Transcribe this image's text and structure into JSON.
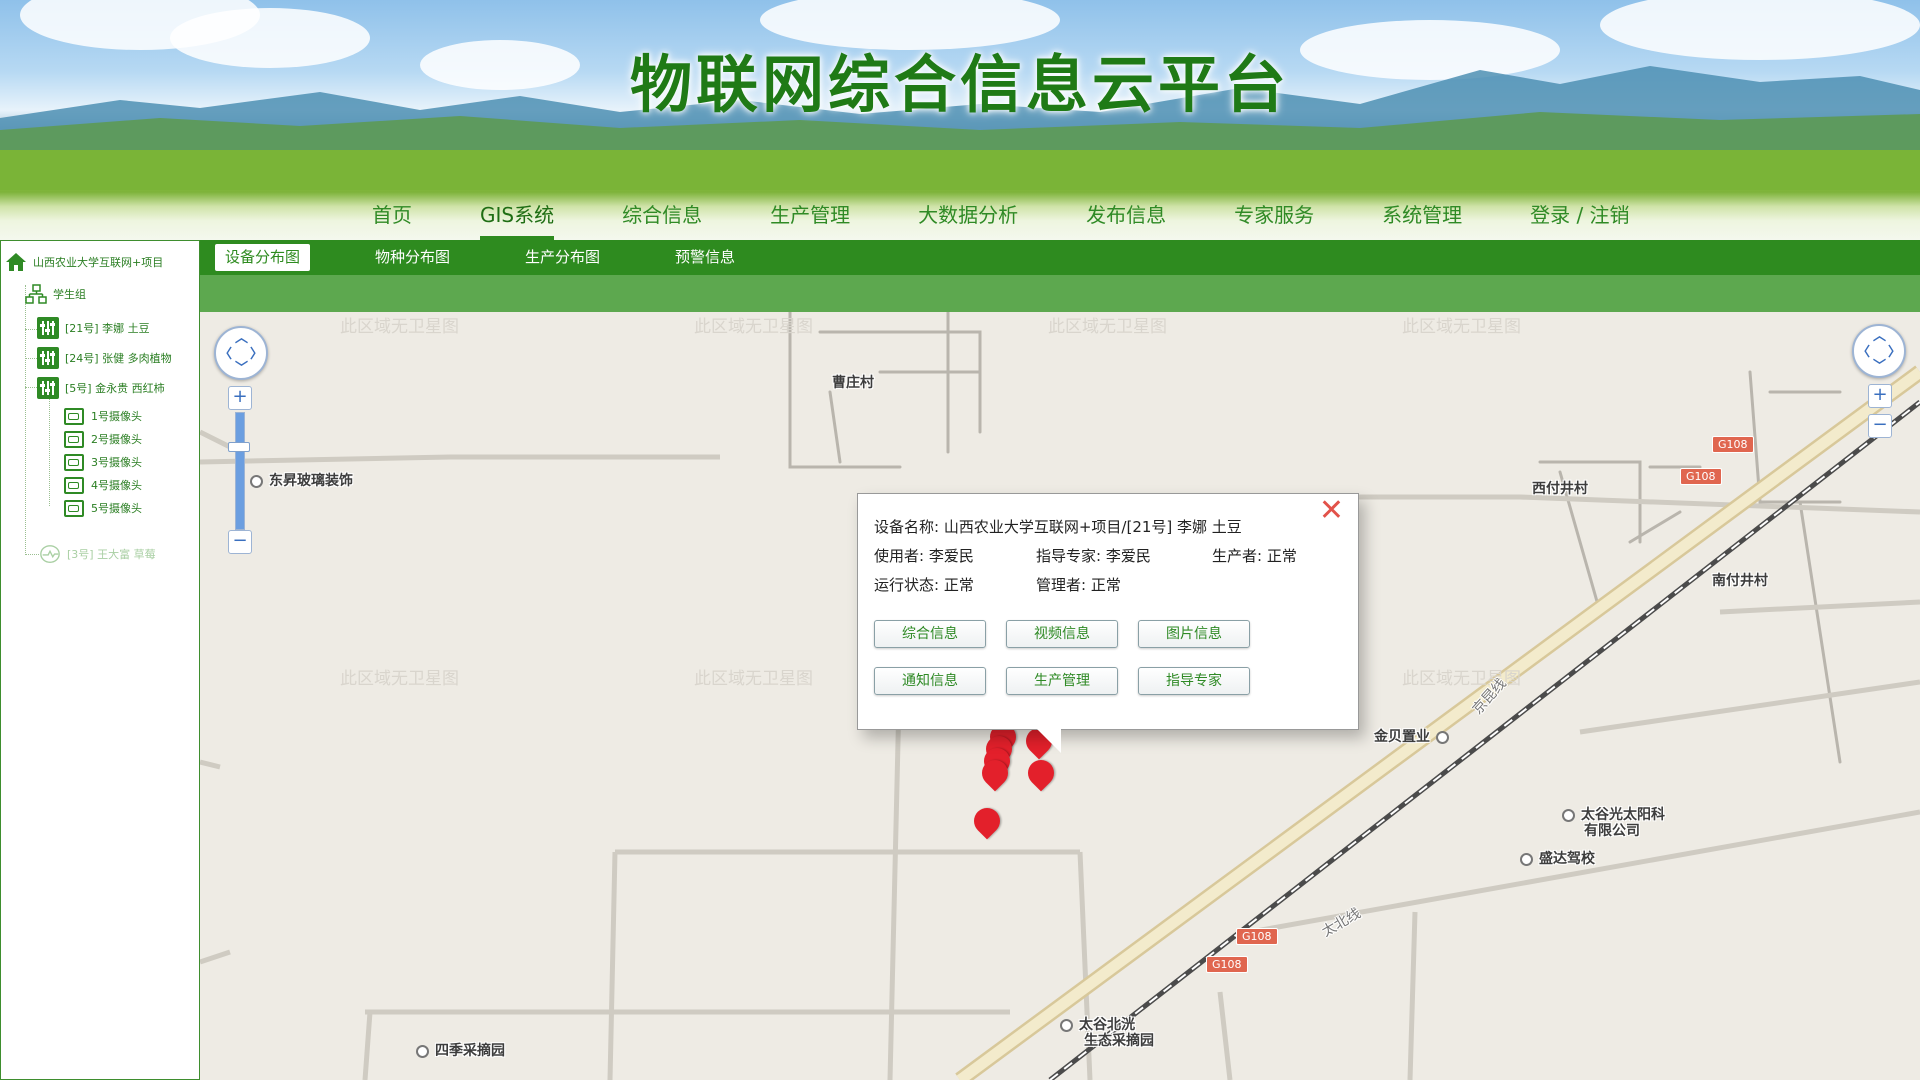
{
  "site": {
    "title": "物联网综合信息云平台"
  },
  "nav": [
    {
      "label": "首页"
    },
    {
      "label": "GIS系统",
      "active": true
    },
    {
      "label": "综合信息"
    },
    {
      "label": "生产管理"
    },
    {
      "label": "大数据分析"
    },
    {
      "label": "发布信息"
    },
    {
      "label": "专家服务"
    },
    {
      "label": "系统管理"
    },
    {
      "label": "登录 / 注销"
    }
  ],
  "subtabs": [
    {
      "label": "设备分布图",
      "active": true
    },
    {
      "label": "物种分布图"
    },
    {
      "label": "生产分布图"
    },
    {
      "label": "预警信息"
    }
  ],
  "tree": {
    "root": "山西农业大学互联网+项目",
    "group": "学生组",
    "devices": [
      {
        "label": "[21号] 李娜 土豆"
      },
      {
        "label": "[24号] 张健 多肉植物"
      },
      {
        "label": "[5号] 金永贵 西红柿"
      }
    ],
    "cameras": [
      "1号摄像头",
      "2号摄像头",
      "3号摄像头",
      "4号摄像头",
      "5号摄像头"
    ],
    "disabled_device": "[3号] 王大富 草莓"
  },
  "map": {
    "watermark": "此区域无卫星图",
    "places": {
      "caozhuang": "曹庄村",
      "dongsheng": "东昇玻璃装饰",
      "xifu": "西付井村",
      "nanfu": "南付井村",
      "jinbei": "金贝置业",
      "taigu_line1": "太谷光太阳科",
      "taigu_line2": "有限公司",
      "shengda": "盛达驾校",
      "taibei": "太谷北洸",
      "taibei2": "生态采摘园",
      "siji": "四季采摘园",
      "jingkun": "京昆线",
      "taibeixian": "太北线"
    },
    "road_shield": "G108",
    "zoom_in": "+",
    "zoom_out": "−"
  },
  "popup": {
    "close": "✕",
    "device_name_label": "设备名称:",
    "device_name": "山西农业大学互联网+项目/[21号] 李娜 土豆",
    "user_label": "使用者:",
    "user": "李爱民",
    "expert_label": "指导专家:",
    "expert": "李爱民",
    "producer_label": "生产者:",
    "producer": "正常",
    "status_label": "运行状态:",
    "status": "正常",
    "manager_label": "管理者:",
    "manager": "正常",
    "buttons": [
      "综合信息",
      "视频信息",
      "图片信息",
      "通知信息",
      "生产管理",
      "指导专家"
    ]
  }
}
